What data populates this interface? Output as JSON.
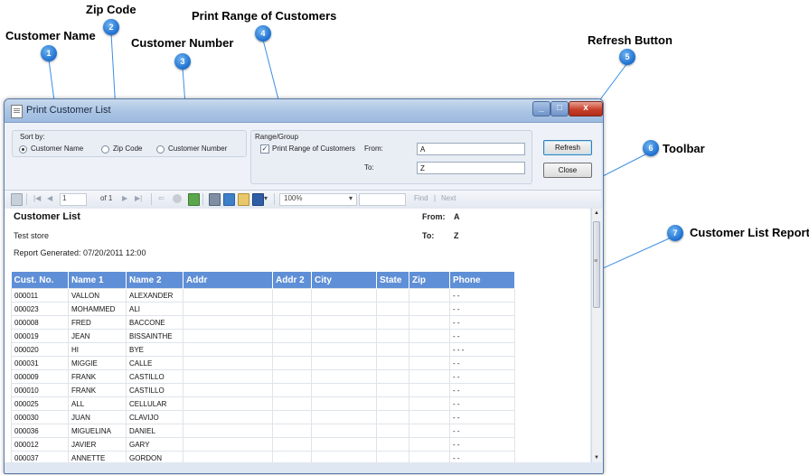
{
  "callouts": [
    {
      "num": "1",
      "label": "Customer Name"
    },
    {
      "num": "2",
      "label": "Zip Code"
    },
    {
      "num": "3",
      "label": "Customer Number"
    },
    {
      "num": "4",
      "label": "Print Range of Customers"
    },
    {
      "num": "5",
      "label": "Refresh Button"
    },
    {
      "num": "6",
      "label": "Toolbar"
    },
    {
      "num": "7",
      "label": "Customer List Report"
    }
  ],
  "window": {
    "title": "Print Customer List",
    "controls": {
      "minimize": "_",
      "maximize": "□",
      "close": "x"
    }
  },
  "sort_by": {
    "label": "Sort by:",
    "options": [
      {
        "label": "Customer Name",
        "selected": true
      },
      {
        "label": "Zip Code",
        "selected": false
      },
      {
        "label": "Customer Number",
        "selected": false
      }
    ]
  },
  "range": {
    "label": "Range/Group",
    "checkbox_label": "Print Range of Customers",
    "checked": true,
    "check_mark": "✓",
    "from_label": "From:",
    "from_value": "A",
    "to_label": "To:",
    "to_value": "Z"
  },
  "buttons": {
    "refresh": "Refresh",
    "close": "Close"
  },
  "toolbar": {
    "page": "1",
    "of_pages": "of 1",
    "zoom": "100%",
    "zoom_arrow": "▾",
    "find": "Find",
    "separator": "|",
    "next": "Next",
    "icons": {
      "first": "|◀",
      "prev": "◀",
      "next": "▶",
      "last": "▶|",
      "back": "⇦",
      "export_arrow": "▾"
    }
  },
  "report": {
    "title": "Customer List",
    "store": "Test store",
    "generated": "Report Generated: 07/20/2011 12:00",
    "from_label": "From:",
    "from_value": "A",
    "to_label": "To:",
    "to_value": "Z",
    "columns": [
      "Cust. No.",
      "Name 1",
      "Name 2",
      "Addr",
      "Addr 2",
      "City",
      "State",
      "Zip",
      "Phone"
    ],
    "rows": [
      [
        "000011",
        "VALLON",
        "ALEXANDER",
        "",
        "",
        "",
        "",
        "",
        "-  -"
      ],
      [
        "000023",
        "MOHAMMED",
        "ALI",
        "",
        "",
        "",
        "",
        "",
        "-  -"
      ],
      [
        "000008",
        "FRED",
        "BACCONE",
        "",
        "",
        "",
        "",
        "",
        "-  -"
      ],
      [
        "000019",
        "JEAN",
        "BISSAINTHE",
        "",
        "",
        "",
        "",
        "",
        "-  -"
      ],
      [
        "000020",
        "HI",
        "BYE",
        "",
        "",
        "",
        "",
        "",
        "-  -  -"
      ],
      [
        "000031",
        "MIGGIE",
        "CALLE",
        "",
        "",
        "",
        "",
        "",
        "-  -"
      ],
      [
        "000009",
        "FRANK",
        "CASTILLO",
        "",
        "",
        "",
        "",
        "",
        "-  -"
      ],
      [
        "000010",
        "FRANK",
        "CASTILLO",
        "",
        "",
        "",
        "",
        "",
        "-  -"
      ],
      [
        "000025",
        "ALL",
        "CELLULAR",
        "",
        "",
        "",
        "",
        "",
        "-  -"
      ],
      [
        "000030",
        "JUAN",
        "CLAVIJO",
        "",
        "",
        "",
        "",
        "",
        "-  -"
      ],
      [
        "000036",
        "MIGUELINA",
        "DANIEL",
        "",
        "",
        "",
        "",
        "",
        "-  -"
      ],
      [
        "000012",
        "JAVIER",
        "GARY",
        "",
        "",
        "",
        "",
        "",
        "-  -"
      ],
      [
        "000037",
        "ANNETTE",
        "GORDON",
        "",
        "",
        "",
        "",
        "",
        "-  -"
      ]
    ]
  },
  "scrollbar": {
    "up": "▲",
    "down": "▼",
    "grip": "≡"
  },
  "colors": {
    "callout_badge": "#1c6fd0",
    "callout_line": "#3a8ee6",
    "report_header": "#5f8fd6",
    "close_button": "#c9402c"
  }
}
